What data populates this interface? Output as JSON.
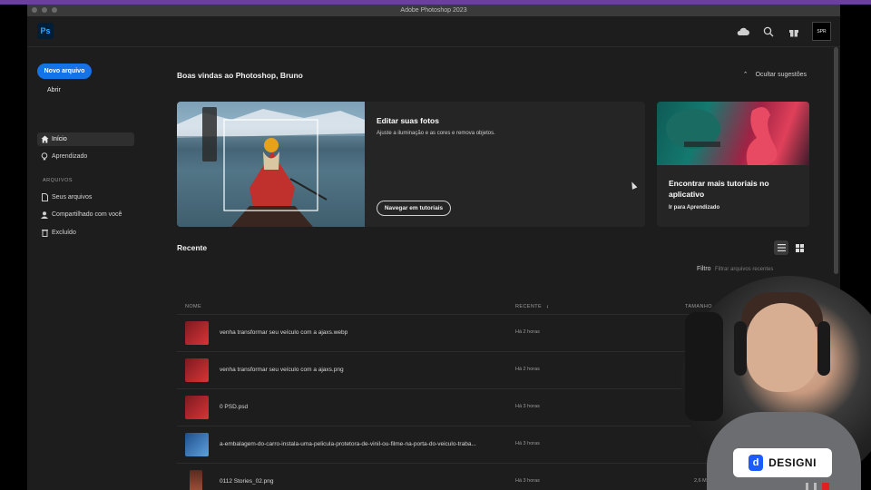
{
  "window": {
    "title": "Adobe Photoshop 2023"
  },
  "topbar": {
    "logo": "Ps",
    "icons": [
      "cloud-icon",
      "search-icon",
      "gift-icon"
    ],
    "avatar_text": "SPR"
  },
  "sidebar": {
    "new_file": "Novo arquivo",
    "open": "Abrir",
    "nav": [
      {
        "label": "Início",
        "icon": "home-icon",
        "active": true
      },
      {
        "label": "Aprendizado",
        "icon": "lightbulb-icon",
        "active": false
      }
    ],
    "files_section": "ARQUIVOS",
    "files": [
      {
        "label": "Seus arquivos",
        "icon": "file-icon"
      },
      {
        "label": "Compartilhado com você",
        "icon": "user-icon"
      },
      {
        "label": "Excluído",
        "icon": "trash-icon"
      }
    ]
  },
  "main": {
    "welcome": "Boas vindas ao Photoshop, Bruno",
    "hide_suggestions": "Ocultar sugestões",
    "hero": {
      "title": "Editar suas fotos",
      "description": "Ajuste a iluminação e as cores e remova objetos.",
      "button": "Navegar em tutoriais"
    },
    "tutorials_card": {
      "title": "Encontrar mais tutoriais no aplicativo",
      "link": "Ir para Aprendizado"
    },
    "recent": {
      "title": "Recente",
      "filter_label": "Filtro",
      "filter_placeholder": "Filtrar arquivos recentes",
      "columns": {
        "name": "NOME",
        "recent": "RECENTE",
        "size": "TAMANHO"
      },
      "rows": [
        {
          "name": "venha transformar seu veículo com a ajaxs.webp",
          "time": "Há 2 horas",
          "size": "",
          "thumb": "#b0262c"
        },
        {
          "name": "venha transformar seu veículo com a ajaxs.png",
          "time": "Há 2 horas",
          "size": "",
          "thumb": "#b0262c"
        },
        {
          "name": "0 PSD.psd",
          "time": "Há 3 horas",
          "size": "",
          "thumb": "#b0262c"
        },
        {
          "name": "a-embalagem-do-carro-instala-uma-pelicula-protetora-de-vinil-ou-filme-na-porta-do-veiculo-traba...",
          "time": "Há 3 horas",
          "size": "",
          "thumb": "#2f6fb0"
        },
        {
          "name": "0112 Stories_02.png",
          "time": "Há 3 horas",
          "size": "2,6 MB",
          "thumb": "#7a3a2a"
        }
      ]
    }
  },
  "overlay": {
    "brand": "DESIGNI"
  }
}
